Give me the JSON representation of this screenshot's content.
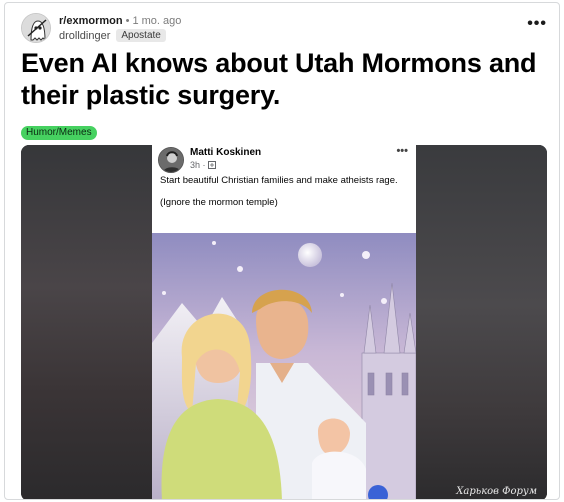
{
  "post": {
    "subreddit": "r/exmormon",
    "separator": "•",
    "time": "1 mo. ago",
    "author": "drolldinger",
    "author_flair": "Apostate",
    "more_label": "•••",
    "title": "Even AI knows about Utah Mormons and their plastic surgery.",
    "flair": "Humor/Memes"
  },
  "embedded": {
    "name": "Matti Koskinen",
    "time": "3h ·",
    "more_label": "•••",
    "line1": "Start beautiful Christian families and make atheists rage.",
    "line2": "(Ignore the mormon temple)",
    "watermark": "Харьков Форум"
  },
  "icons": {
    "subreddit": "ghost-avatar-icon",
    "more": "ellipsis-icon",
    "audience": "globe-icon"
  },
  "colors": {
    "flair_bg": "#46d160",
    "author_flair_bg": "#e8e8e8"
  }
}
